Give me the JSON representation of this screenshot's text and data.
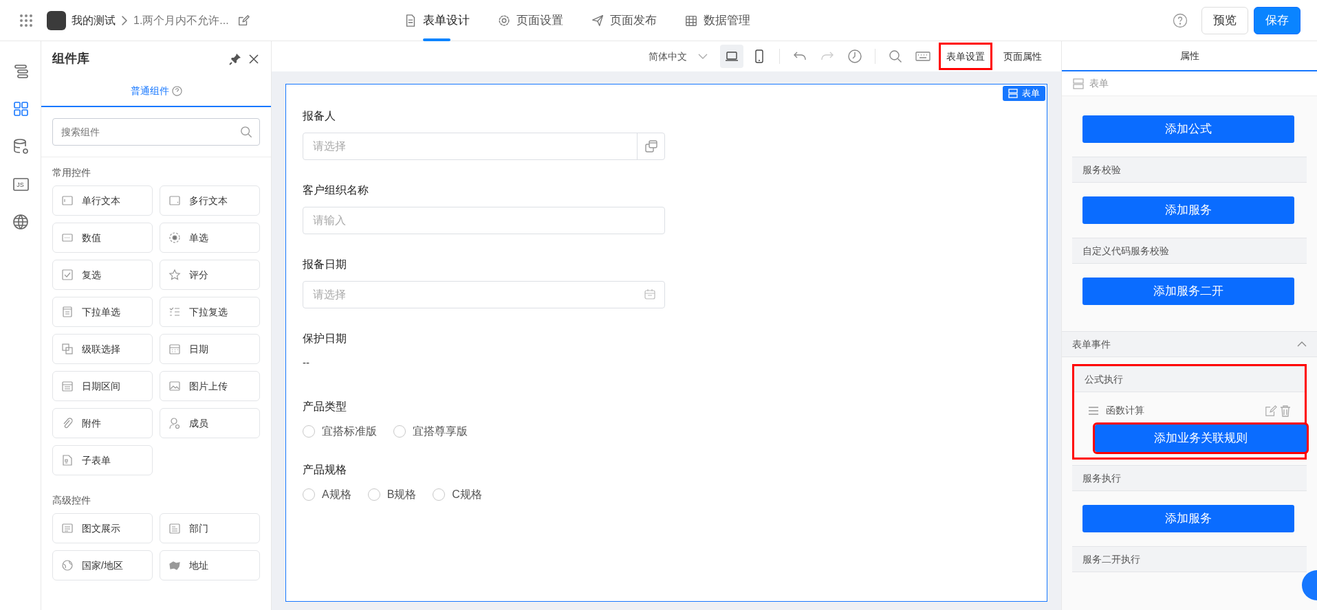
{
  "header": {
    "app_name": "我的测试",
    "page_title": "1.两个月内不允许...",
    "tabs": [
      {
        "kind": "doc",
        "label": "表单设计",
        "selected": true
      },
      {
        "kind": "gear",
        "label": "页面设置",
        "selected": false
      },
      {
        "kind": "send",
        "label": "页面发布",
        "selected": false
      },
      {
        "kind": "grid",
        "label": "数据管理",
        "selected": false
      }
    ],
    "preview": "预览",
    "save": "保存"
  },
  "rail": [
    {
      "kind": "outline",
      "selected": false
    },
    {
      "kind": "components",
      "selected": true
    },
    {
      "kind": "database",
      "selected": false
    },
    {
      "kind": "js",
      "label": "JS",
      "selected": false
    },
    {
      "kind": "globe",
      "selected": false
    }
  ],
  "library": {
    "title": "组件库",
    "tab": "普通组件",
    "search_placeholder": "搜索组件",
    "groups": [
      {
        "title": "常用控件",
        "items": [
          {
            "kind": "textline",
            "label": "单行文本"
          },
          {
            "kind": "textarea",
            "label": "多行文本"
          },
          {
            "kind": "number",
            "label": "数值"
          },
          {
            "kind": "radio",
            "label": "单选"
          },
          {
            "kind": "checkbox",
            "label": "复选"
          },
          {
            "kind": "star",
            "label": "评分"
          },
          {
            "kind": "dropdown",
            "label": "下拉单选"
          },
          {
            "kind": "multi",
            "label": "下拉复选"
          },
          {
            "kind": "cascade",
            "label": "级联选择"
          },
          {
            "kind": "calendar",
            "label": "日期"
          },
          {
            "kind": "daterange",
            "label": "日期区间"
          },
          {
            "kind": "image",
            "label": "图片上传"
          },
          {
            "kind": "clip",
            "label": "附件"
          },
          {
            "kind": "person",
            "label": "成员"
          },
          {
            "kind": "subform",
            "label": "子表单"
          }
        ]
      },
      {
        "title": "高级控件",
        "items": [
          {
            "kind": "article",
            "label": "图文展示"
          },
          {
            "kind": "department",
            "label": "部门"
          },
          {
            "kind": "globe",
            "label": "国家/地区"
          },
          {
            "kind": "map",
            "label": "地址"
          }
        ]
      }
    ]
  },
  "toolbar": {
    "language": "简体中文",
    "devices": [
      {
        "kind": "desktop",
        "selected": true
      },
      {
        "kind": "mobile",
        "selected": false
      }
    ],
    "tabs": [
      {
        "label": "表单设置",
        "highlighted": true
      },
      {
        "label": "页面属性",
        "highlighted": false
      }
    ]
  },
  "form": {
    "badge": "表单",
    "fields": [
      {
        "kind": "picker",
        "label": "报备人",
        "placeholder": "请选择"
      },
      {
        "kind": "input",
        "label": "客户组织名称",
        "placeholder": "请输入"
      },
      {
        "kind": "date",
        "label": "报备日期",
        "placeholder": "请选择"
      },
      {
        "kind": "text",
        "label": "保护日期",
        "value": "--"
      },
      {
        "kind": "radio",
        "label": "产品类型",
        "options": [
          {
            "label": "宜搭标准版",
            "selected": false
          },
          {
            "label": "宜搭尊享版",
            "selected": false
          }
        ]
      },
      {
        "kind": "radio",
        "label": "产品规格",
        "options": [
          {
            "label": "A规格",
            "selected": false
          },
          {
            "label": "B规格",
            "selected": false
          },
          {
            "label": "C规格",
            "selected": false
          }
        ]
      }
    ]
  },
  "properties": {
    "tab": "属性",
    "breadcrumb": "表单",
    "blocks": [
      {
        "kind": "section",
        "button": "添加公式"
      },
      {
        "kind": "section",
        "title": "服务校验",
        "button": "添加服务"
      },
      {
        "kind": "section",
        "title": "自定义代码服务校验",
        "button": "添加服务二开"
      },
      {
        "kind": "group",
        "title": "表单事件",
        "expanded": true
      },
      {
        "kind": "section",
        "title": "公式执行",
        "highlighted": true,
        "rules": [
          "函数计算"
        ],
        "button": "添加业务关联规则",
        "button_highlighted": true
      },
      {
        "kind": "section",
        "title": "服务执行",
        "button": "添加服务"
      },
      {
        "kind": "section",
        "title": "服务二开执行"
      }
    ]
  }
}
